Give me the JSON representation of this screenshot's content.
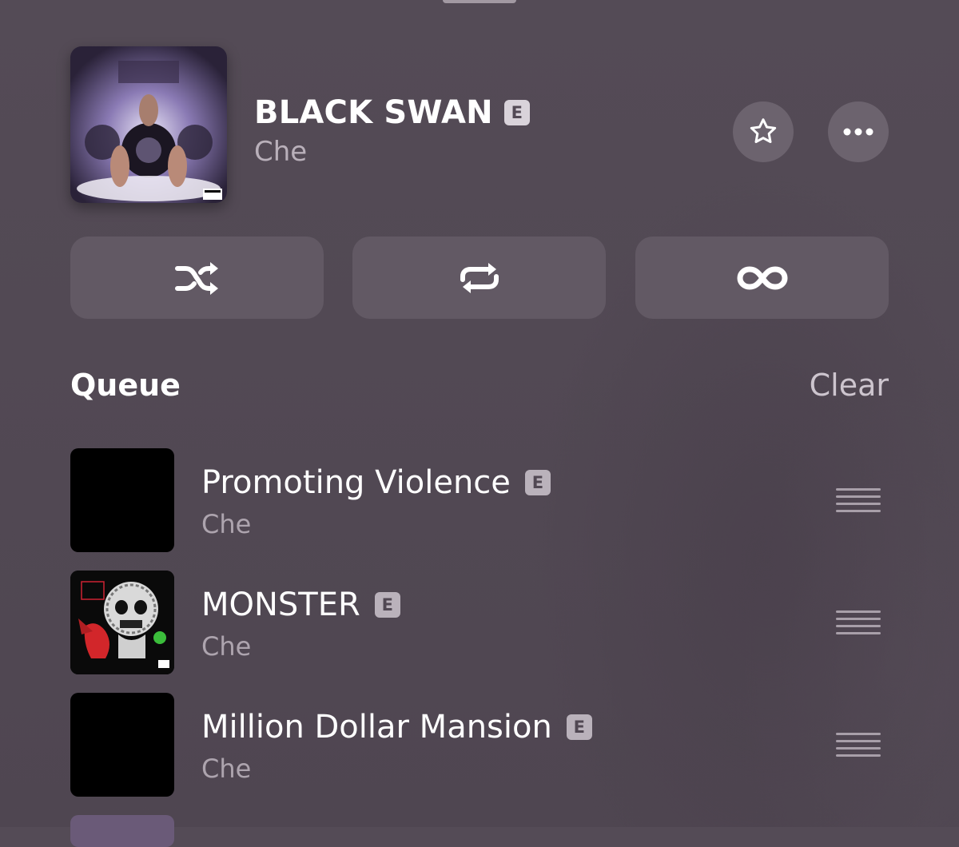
{
  "now_playing": {
    "title": "BLACK SWAN",
    "explicit_badge": "E",
    "artist": "Che",
    "artwork": "album-cover-art",
    "actions": {
      "favorite_icon": "star-icon",
      "more_icon": "ellipsis-icon"
    }
  },
  "playback_modes": [
    {
      "icon": "shuffle-icon"
    },
    {
      "icon": "repeat-icon"
    },
    {
      "icon": "infinity-icon"
    }
  ],
  "queue": {
    "title": "Queue",
    "clear_label": "Clear",
    "items": [
      {
        "title": "Promoting Violence",
        "explicit_badge": "E",
        "artist": "Che",
        "artwork": "black-placeholder"
      },
      {
        "title": "MONSTER",
        "explicit_badge": "E",
        "artist": "Che",
        "artwork": "skull-devil-cover-art"
      },
      {
        "title": "Million Dollar Mansion",
        "explicit_badge": "E",
        "artist": "Che",
        "artwork": "black-placeholder"
      }
    ]
  },
  "colors": {
    "background": "#514853",
    "button_bg": "#625964",
    "circle_button_bg": "#6c636e",
    "secondary_text": "#b9b0ba",
    "explicit_badge_bg": "#d9d3da"
  }
}
